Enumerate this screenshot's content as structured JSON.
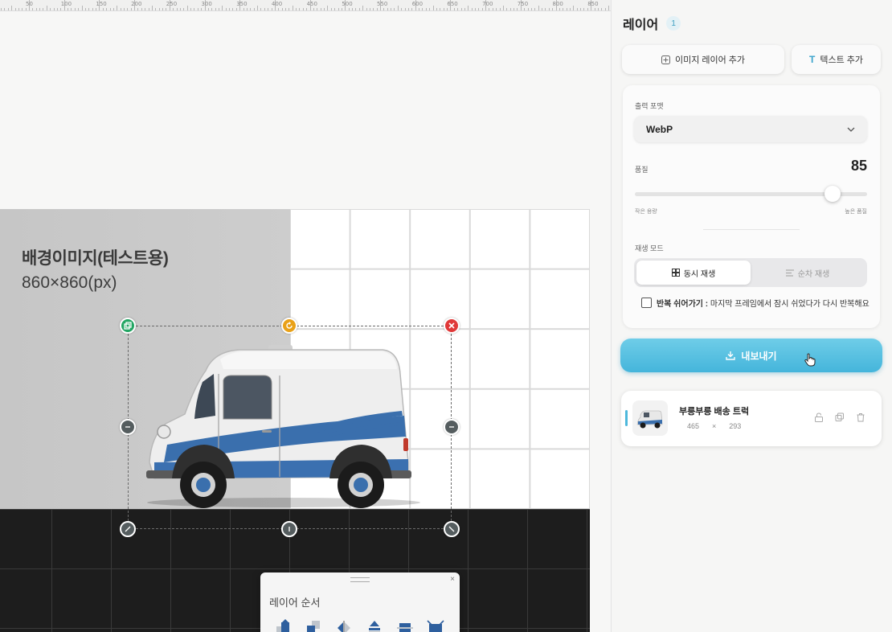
{
  "ruler": {
    "labels": [
      "50",
      "100",
      "150",
      "200",
      "250",
      "300",
      "350",
      "400",
      "450",
      "500",
      "550",
      "600",
      "650",
      "700",
      "750",
      "800",
      "850"
    ]
  },
  "canvas": {
    "background_title": "배경이미지(테스트용)",
    "background_size": "860×860(px)",
    "colors": {
      "selection_green": "#22a563",
      "rotate_orange": "#e9a118",
      "delete_red": "#e03838"
    }
  },
  "order_panel": {
    "title": "레이어 순서",
    "close": "×",
    "icons": [
      "bring-to-front-icon",
      "bring-forward-icon",
      "flip-horizontal-icon",
      "align-top-icon",
      "align-center-icon",
      "fit-canvas-icon"
    ]
  },
  "sidebar": {
    "title": "레이어",
    "count": "1",
    "add_image_label": "이미지 레이어 추가",
    "add_text_label": "텍스트 추가",
    "format_label": "출력 포맷",
    "format_value": "WebP",
    "quality_label": "품질",
    "quality_value": "85",
    "quality_min_label": "작은 용량",
    "quality_max_label": "높은 품질",
    "playback_label": "재생 모드",
    "playback_options": [
      "동시 재생",
      "순차 재생"
    ],
    "loop_bold": "반복 쉬어가기 :",
    "loop_text": "마지막 프레임에서 잠시 쉬었다가 다시 반복해요",
    "export_label": "내보내기",
    "accent_color": "#45b5db"
  },
  "layer": {
    "name": "부릉부릉 배송 트럭",
    "width": "465",
    "times": "×",
    "height": "293"
  }
}
